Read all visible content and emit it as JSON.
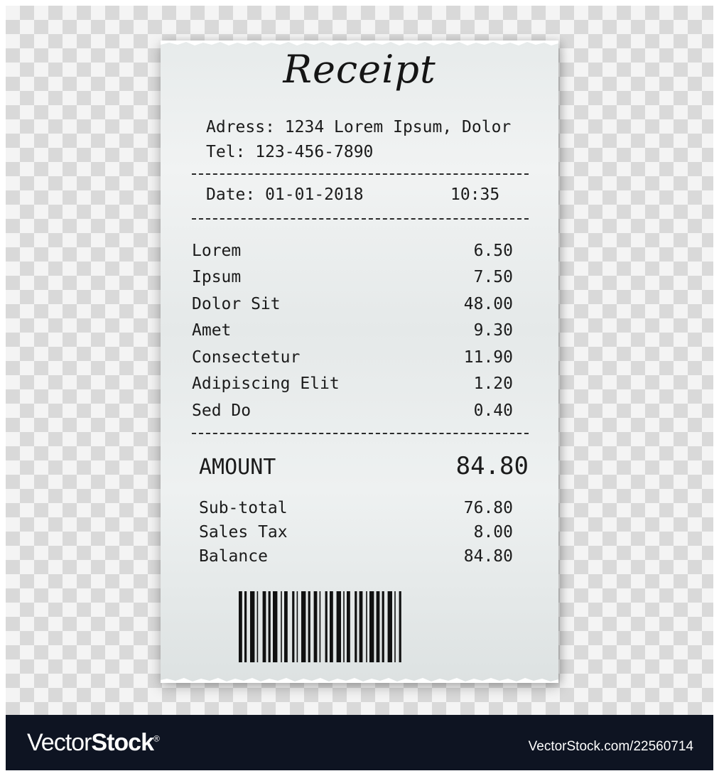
{
  "receipt": {
    "title": "Receipt",
    "address": "Adress: 1234 Lorem Ipsum, Dolor",
    "tel": "Tel: 123-456-7890",
    "date": "Date: 01-01-2018",
    "time": "10:35",
    "items": [
      {
        "name": "Lorem",
        "price": "6.50"
      },
      {
        "name": "Ipsum",
        "price": "7.50"
      },
      {
        "name": "Dolor Sit",
        "price": "48.00"
      },
      {
        "name": "Amet",
        "price": "9.30"
      },
      {
        "name": "Consectetur",
        "price": "11.90"
      },
      {
        "name": "Adipiscing Elit",
        "price": "1.20"
      },
      {
        "name": "Sed Do",
        "price": "0.40"
      }
    ],
    "amount_label": "AMOUNT",
    "amount_value": "84.80",
    "subtotal_label": "Sub-total",
    "subtotal_value": "76.80",
    "tax_label": "Sales Tax",
    "tax_value": "8.00",
    "balance_label": "Balance",
    "balance_value": "84.80"
  },
  "footer": {
    "brand_light": "Vector",
    "brand_strong": "Stock",
    "brand_mark": "®",
    "stock_id": "VectorStock.com/22560714"
  },
  "colors": {
    "footer_bg": "#0e1422",
    "paper": "#e9eded",
    "ink": "#1b1b1b"
  }
}
